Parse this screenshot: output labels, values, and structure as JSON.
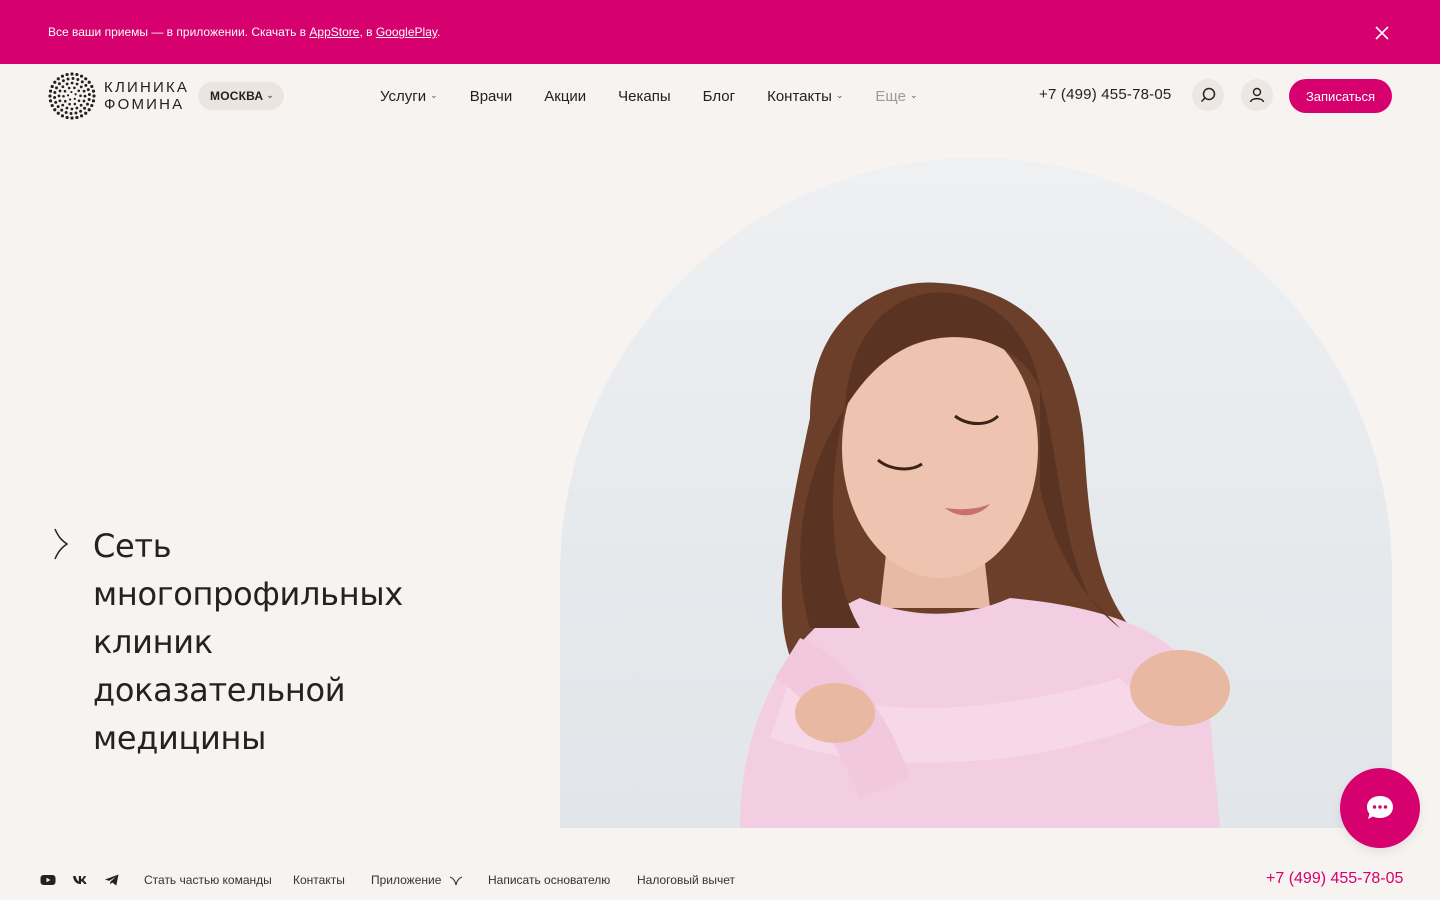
{
  "promo": {
    "text_before": "Все ваши приемы — в приложении. Скачать в ",
    "appstore": "AppStore",
    "sep": ", в ",
    "googleplay": "GooglePlay",
    "end": "."
  },
  "header": {
    "logo_line1": "КЛИНИКА",
    "logo_line2": "ФОМИНА",
    "city": "МОСКВА",
    "nav": [
      "Услуги",
      "Врачи",
      "Акции",
      "Чекапы",
      "Блог",
      "Контакты",
      "Еще"
    ],
    "phone": "+7 (499) 455-78-05",
    "signup": "Записаться"
  },
  "hero": {
    "title_lines": [
      "Сеть",
      "многопрофильных",
      "клиник",
      "доказательной",
      "медицины"
    ]
  },
  "footer": {
    "links": [
      "Стать частью команды",
      "Контакты",
      "Приложение",
      "Написать основателю",
      "Налоговый вычет"
    ],
    "phone": "+7 (499) 455-78-05"
  },
  "colors": {
    "accent": "#d6006f",
    "background": "#f6f3f1",
    "text": "#222222"
  },
  "icons": [
    "close-icon",
    "search-icon",
    "user-icon",
    "chat-icon",
    "youtube-icon",
    "vk-icon",
    "telegram-icon",
    "chevron-down-icon"
  ]
}
